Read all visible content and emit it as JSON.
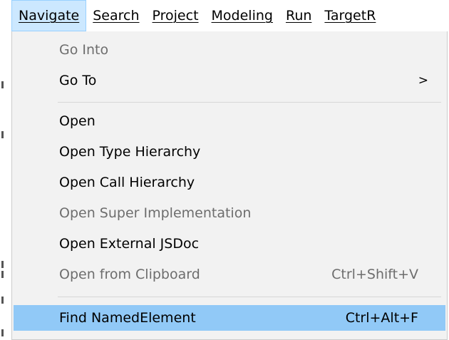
{
  "menubar": {
    "items": [
      {
        "label": "Navigate",
        "active": true
      },
      {
        "label": "Search",
        "active": false
      },
      {
        "label": "Project",
        "active": false
      },
      {
        "label": "Modeling",
        "active": false
      },
      {
        "label": "Run",
        "active": false
      },
      {
        "label": "TargetR",
        "active": false
      }
    ]
  },
  "navigate_menu": {
    "go_into": {
      "label": "Go Into",
      "enabled": false
    },
    "go_to": {
      "label": "Go To",
      "submenu_arrow": ">",
      "enabled": true
    },
    "open": {
      "label": "Open",
      "enabled": true
    },
    "open_type_hierarchy": {
      "label": "Open Type Hierarchy",
      "enabled": true
    },
    "open_call_hierarchy": {
      "label": "Open Call Hierarchy",
      "enabled": true
    },
    "open_super_implementation": {
      "label": "Open Super Implementation",
      "enabled": false
    },
    "open_external_jsdoc": {
      "label": "Open External JSDoc",
      "enabled": true
    },
    "open_from_clipboard": {
      "label": "Open from Clipboard",
      "shortcut": "Ctrl+Shift+V",
      "enabled": false
    },
    "find_named_element": {
      "label": "Find NamedElement",
      "shortcut": "Ctrl+Alt+F",
      "enabled": true,
      "highlighted": true
    }
  },
  "colors": {
    "menu_background": "#f2f2f2",
    "highlight": "#91c9f7",
    "active_menubar": "#cce8ff",
    "disabled_text": "#6d6d6d"
  },
  "icons": {
    "submenu": "chevron-right-icon"
  }
}
